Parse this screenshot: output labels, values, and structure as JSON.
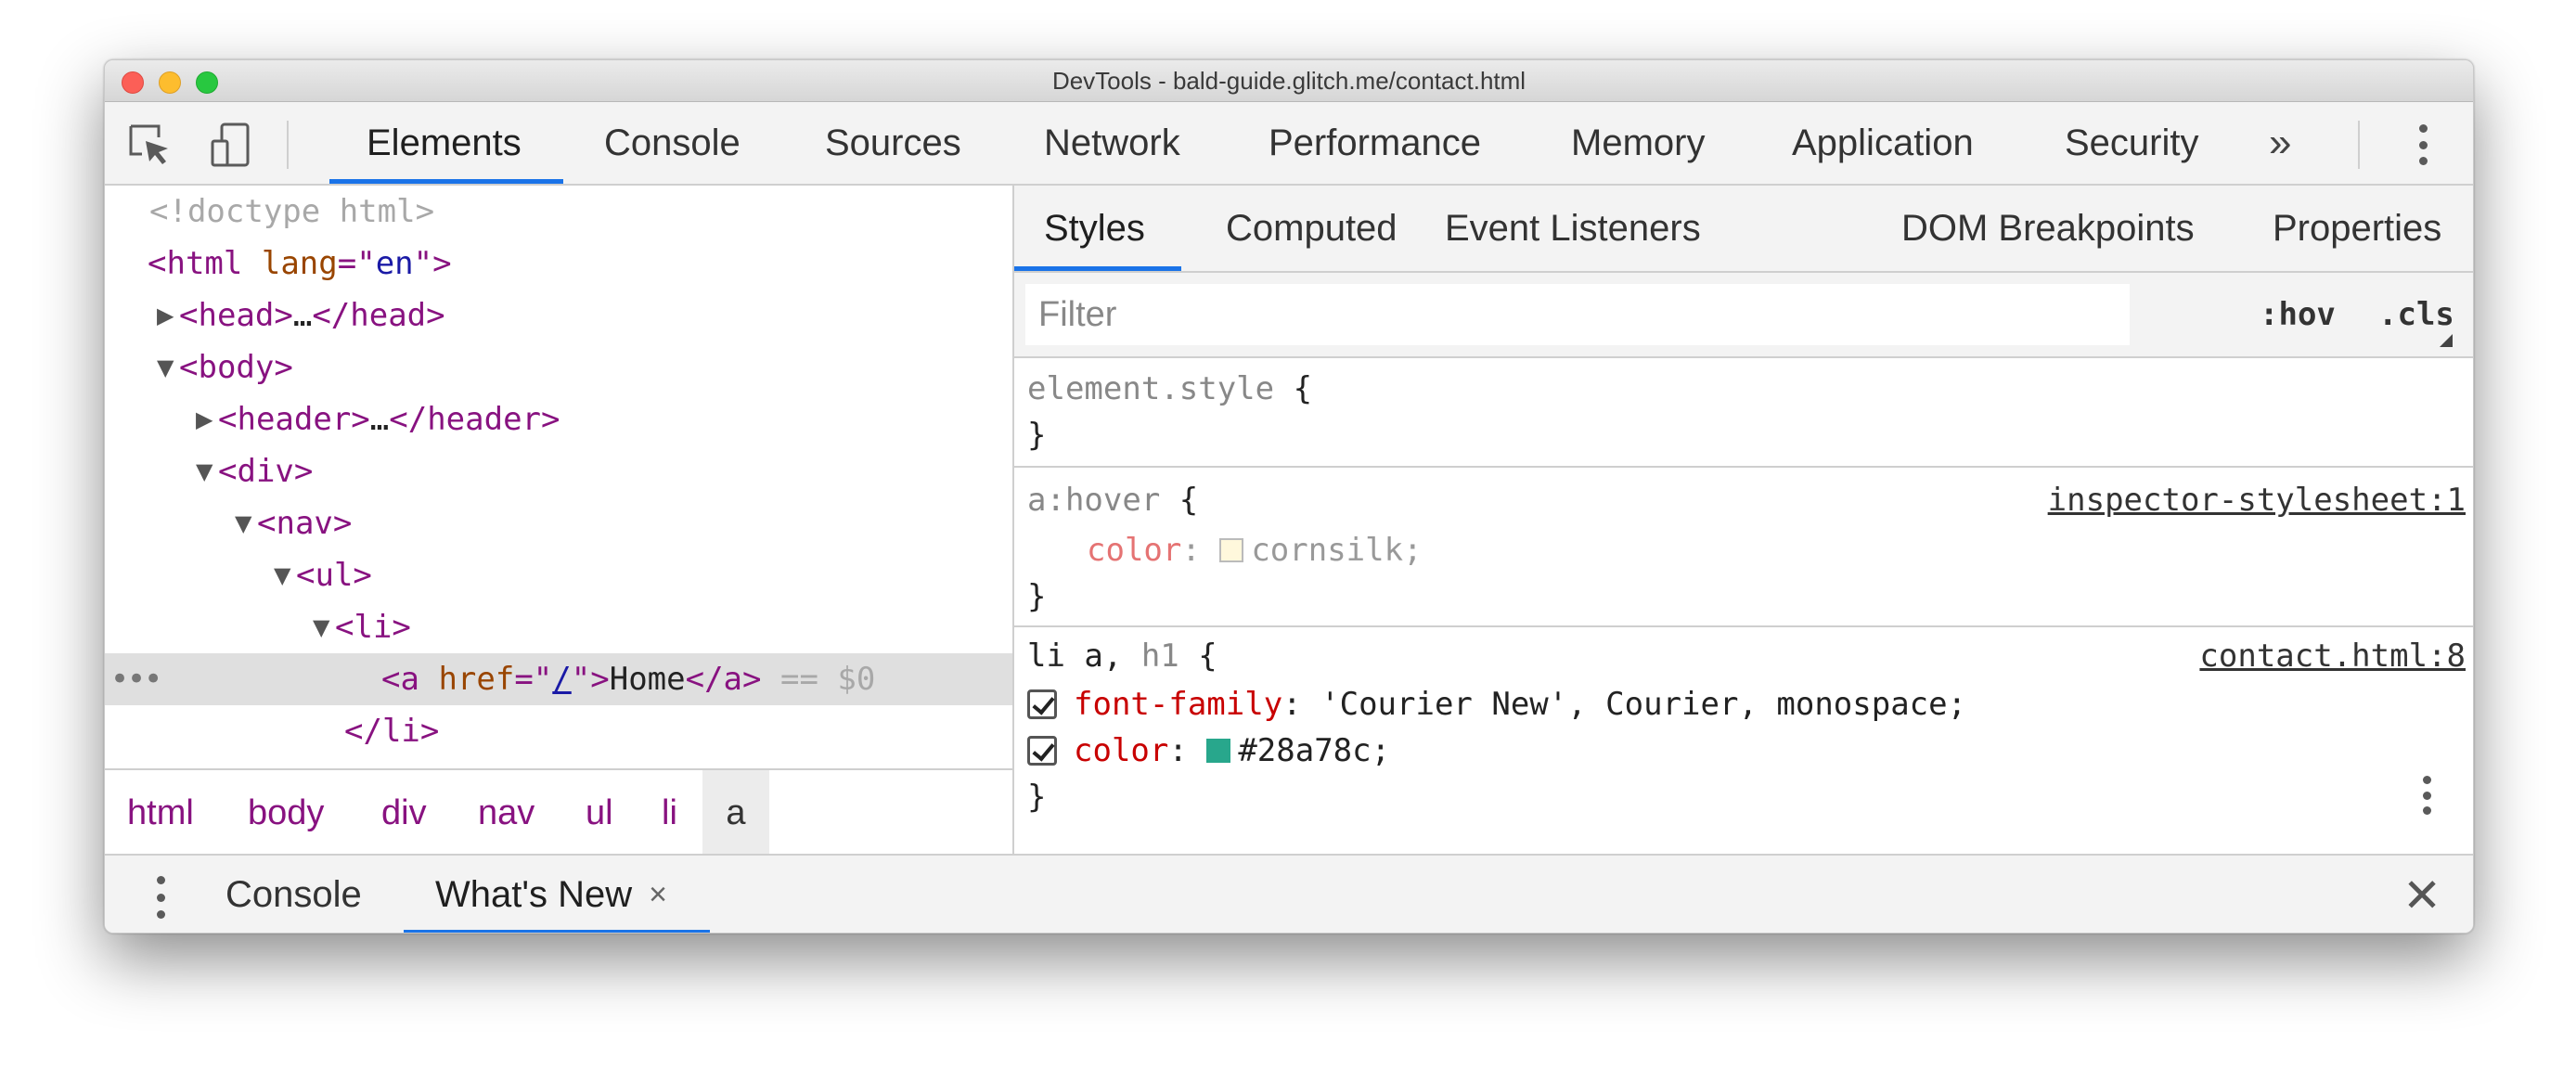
{
  "window": {
    "title": "DevTools - bald-guide.glitch.me/contact.html"
  },
  "toolbar": {
    "inspect_icon": "cursor-inspect-icon",
    "device_icon": "device-toggle-icon",
    "tabs": [
      "Elements",
      "Console",
      "Sources",
      "Network",
      "Performance",
      "Memory",
      "Application",
      "Security"
    ],
    "active_tab": "Elements",
    "more_label": "»",
    "accent_color": "#1a73e8"
  },
  "dom": {
    "doctype": "<!doctype html>",
    "html_open_tag": "<html",
    "html_attr": "lang",
    "html_attr_val": "en",
    "head_collapsed": "…",
    "head_tag_open": "<head>",
    "head_tag_close": "</head>",
    "body_tag": "<body>",
    "header_tag_open": "<header>",
    "header_tag_close": "</header>",
    "div_tag": "<div>",
    "nav_tag": "<nav>",
    "ul_tag": "<ul>",
    "li_tag": "<li>",
    "li_close": "</li>",
    "a_open": "<a",
    "a_attr": "href",
    "a_val": "/",
    "a_text": "Home",
    "a_close": "</a>",
    "selected_marker": "== $0",
    "ellipsis": "•••"
  },
  "breadcrumbs": [
    "html",
    "body",
    "div",
    "nav",
    "ul",
    "li",
    "a"
  ],
  "styles": {
    "tabs": [
      "Styles",
      "Computed",
      "Event Listeners",
      "DOM Breakpoints",
      "Properties"
    ],
    "active_tab": "Styles",
    "more_label": "»",
    "filter_placeholder": "Filter",
    "hov_label": ":hov",
    "cls_label": ".cls",
    "plus_label": "+",
    "rules": {
      "element_style": {
        "selector": "element.style",
        "open": " {",
        "close": "}"
      },
      "hover": {
        "selector": "a:hover",
        "open": " {",
        "source": "inspector-stylesheet:1",
        "prop": "color",
        "value": "cornsilk;",
        "swatch": "#fff8dc",
        "close": "}"
      },
      "li_a": {
        "selector_match": "li a,",
        "selector_rest": " h1",
        "open": " {",
        "source": "contact.html:8",
        "font_prop": "font-family",
        "font_value": "'Courier New', Courier, monospace;",
        "color_prop": "color",
        "color_value": "#28a78c;",
        "swatch": "#28a78c",
        "close": "}"
      }
    }
  },
  "drawer": {
    "tabs": [
      "Console",
      "What's New"
    ],
    "active_tab": "What's New",
    "tab_close": "×",
    "close_label": "✕"
  }
}
